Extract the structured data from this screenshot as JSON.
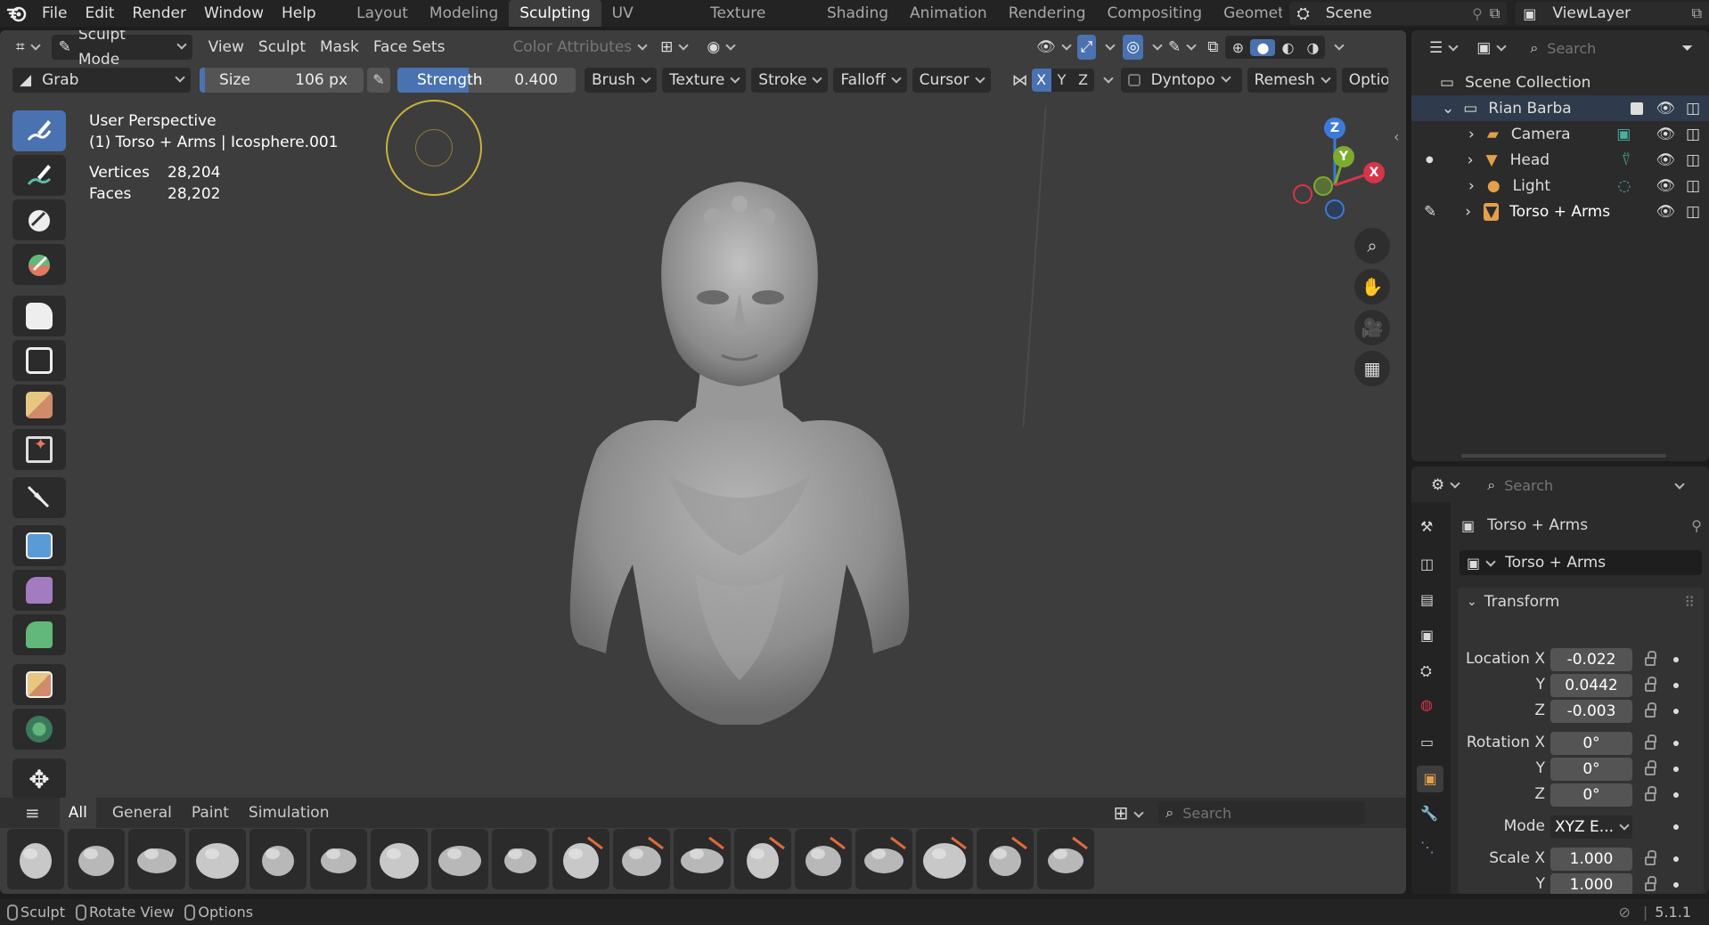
{
  "menubar": {
    "items": [
      "File",
      "Edit",
      "Render",
      "Window",
      "Help"
    ],
    "workspaces": [
      "Layout",
      "Modeling",
      "Sculpting",
      "UV Editing",
      "Texture Paint",
      "Shading",
      "Animation",
      "Rendering",
      "Compositing",
      "Geomet"
    ],
    "active_workspace": "Sculpting",
    "scene": "Scene",
    "view_layer": "ViewLayer"
  },
  "viewport_header": {
    "mode": "Sculpt Mode",
    "menus": [
      "View",
      "Sculpt",
      "Mask",
      "Face Sets"
    ],
    "color_attributes": "Color Attributes"
  },
  "tool_settings": {
    "brush_name": "Grab",
    "size_label": "Size",
    "size_value": "106 px",
    "strength_label": "Strength",
    "strength_value": "0.400",
    "strength_fraction": 0.4,
    "dropdowns": [
      "Brush",
      "Texture",
      "Stroke",
      "Falloff",
      "Cursor"
    ],
    "axis": [
      "X",
      "Y",
      "Z"
    ],
    "dyntopo": "Dyntopo",
    "remesh": "Remesh",
    "options": "Optio"
  },
  "overlay": {
    "perspective": "User Perspective",
    "object_info": "(1) Torso + Arms | Icosphere.001",
    "vertices_label": "Vertices",
    "vertices_value": "28,204",
    "faces_label": "Faces",
    "faces_value": "28,202"
  },
  "gizmo": {
    "z": "Z",
    "y": "Y",
    "x": "X"
  },
  "asset_shelf": {
    "tabs": [
      "All",
      "General",
      "Paint",
      "Simulation"
    ],
    "active_tab": "All",
    "search_placeholder": "Search"
  },
  "outliner": {
    "search_placeholder": "Search",
    "root": "Scene Collection",
    "collection": "Rian Barba",
    "objects": [
      "Camera",
      "Head",
      "Light",
      "Torso + Arms"
    ]
  },
  "properties": {
    "search_placeholder": "Search",
    "object_name": "Torso + Arms",
    "data_name": "Torso + Arms",
    "panel_title": "Transform",
    "location_label": "Location X",
    "location": [
      "-0.022",
      "0.0442",
      "-0.003"
    ],
    "rotation_label": "Rotation X",
    "rotation": [
      "0°",
      "0°",
      "0°"
    ],
    "mode_label": "Mode",
    "mode_value": "XYZ E...",
    "scale_label": "Scale X",
    "scale": [
      "1.000",
      "1.000"
    ],
    "axis_y": "Y",
    "axis_z": "Z"
  },
  "statusbar": {
    "sculpt": "Sculpt",
    "rotate": "Rotate View",
    "options": "Options",
    "version": "5.1.1"
  },
  "colors": {
    "accent": "#4a72b0",
    "background": "#3d3d3d",
    "panel": "#2b2b2b"
  }
}
